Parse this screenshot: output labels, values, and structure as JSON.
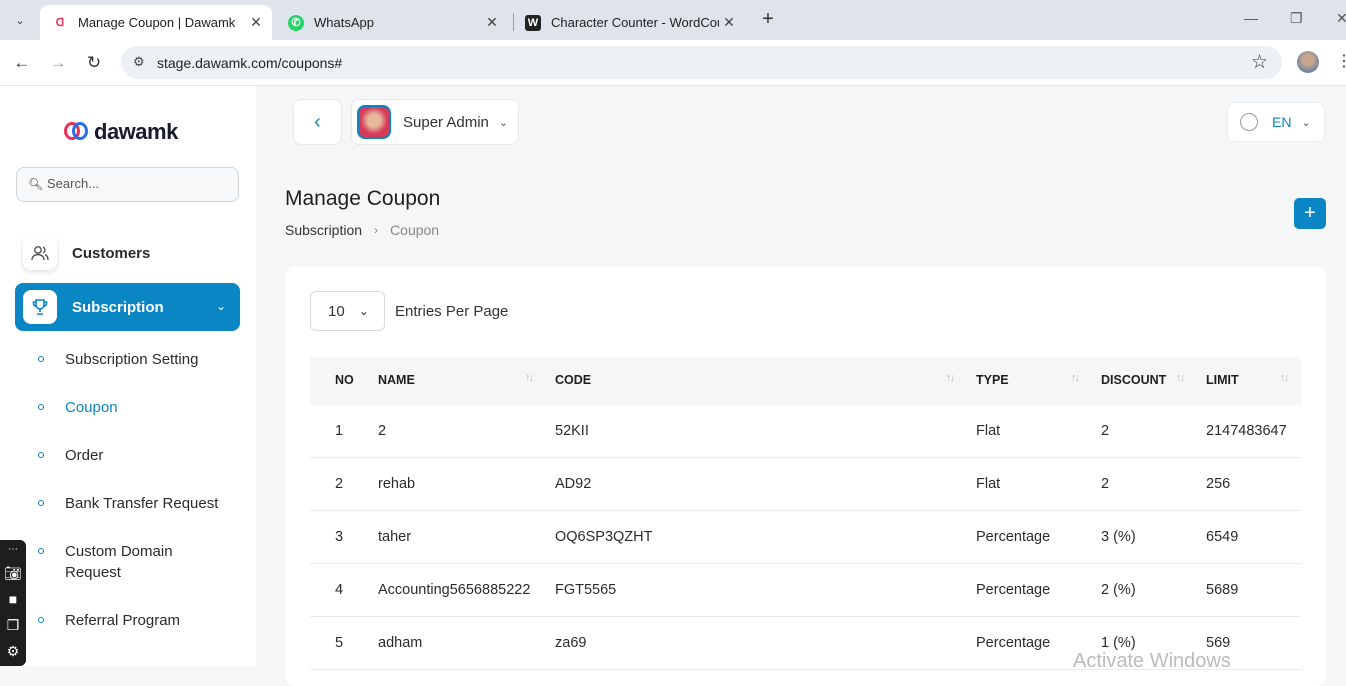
{
  "browser": {
    "tabs": [
      {
        "title": "Manage Coupon | Dawamk",
        "active": true
      },
      {
        "title": "WhatsApp",
        "active": false
      },
      {
        "title": "Character Counter - WordCount",
        "active": false
      }
    ],
    "url": "stage.dawamk.com/coupons#"
  },
  "sidebar": {
    "logo_text": "dawamk",
    "search_placeholder": "Search...",
    "customers_label": "Customers",
    "subscription_label": "Subscription",
    "sub_items": [
      {
        "label": "Subscription Setting"
      },
      {
        "label": "Coupon"
      },
      {
        "label": "Order"
      },
      {
        "label": "Bank Transfer Request"
      },
      {
        "label": "Custom Domain Request"
      },
      {
        "label": "Referral Program"
      }
    ]
  },
  "header": {
    "user_name": "Super Admin",
    "language": "EN"
  },
  "page": {
    "title": "Manage Coupon",
    "breadcrumb": {
      "parent": "Subscription",
      "current": "Coupon"
    }
  },
  "table_controls": {
    "entries_value": "10",
    "entries_label": "Entries Per Page"
  },
  "table": {
    "columns": [
      "NO",
      "NAME",
      "CODE",
      "TYPE",
      "DISCOUNT",
      "LIMIT"
    ],
    "rows": [
      [
        "1",
        "2",
        "52KII",
        "Flat",
        "2",
        "2147483647"
      ],
      [
        "2",
        "rehab",
        "AD92",
        "Flat",
        "2",
        "256"
      ],
      [
        "3",
        "taher",
        "OQ6SP3QZHT",
        "Percentage",
        "3 (%)",
        "6549"
      ],
      [
        "4",
        "Accounting5656885222",
        "FGT5565",
        "Percentage",
        "2 (%)",
        "5689"
      ],
      [
        "5",
        "adham",
        "za69",
        "Percentage",
        "1 (%)",
        "569"
      ]
    ]
  },
  "watermark": "Activate Windows",
  "colors": {
    "accent": "#0a86c5",
    "brand": "#e8305b"
  }
}
